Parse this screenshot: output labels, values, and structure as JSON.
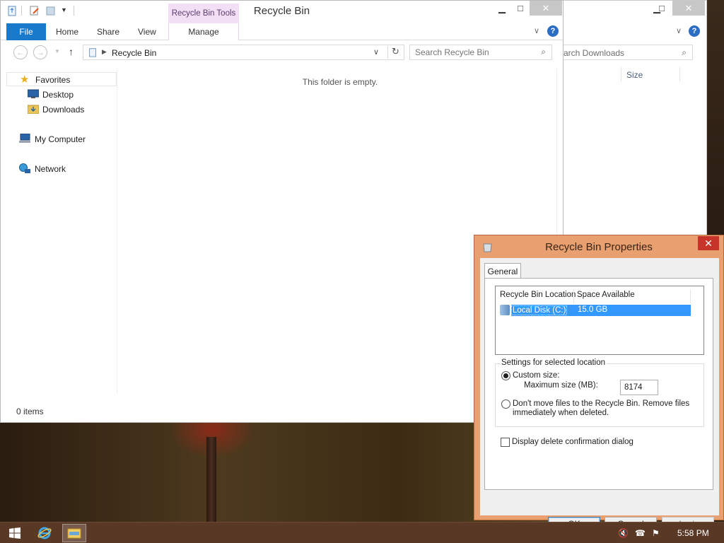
{
  "explorer": {
    "title": "Recycle Bin",
    "context_tab": "Recycle Bin Tools",
    "tabs": {
      "file": "File",
      "home": "Home",
      "share": "Share",
      "view": "View",
      "manage": "Manage"
    },
    "address": "Recycle Bin",
    "search_placeholder": "Search Recycle Bin",
    "nav": {
      "favorites": "Favorites",
      "desktop": "Desktop",
      "downloads": "Downloads",
      "my_computer": "My Computer",
      "network": "Network"
    },
    "empty_message": "This folder is empty.",
    "status": "0 items",
    "help": "?"
  },
  "downloads_window": {
    "search_placeholder": "arch Downloads",
    "column_size": "Size"
  },
  "dialog": {
    "title": "Recycle Bin Properties",
    "tab": "General",
    "columns": {
      "location": "Recycle Bin Location",
      "space": "Space Available"
    },
    "rows": [
      {
        "location": "Local Disk (C:)",
        "space": "15.0 GB"
      }
    ],
    "group_label": "Settings for selected location",
    "custom_size": "Custom size:",
    "max_size_label": "Maximum size (MB):",
    "max_size_value": "8174",
    "dont_move_line1": "Don't move files to the Recycle Bin. Remove files",
    "dont_move_line2": "immediately when deleted.",
    "confirm_label": "Display delete confirmation dialog",
    "buttons": {
      "ok": "OK",
      "cancel": "Cancel",
      "apply": "Apply"
    },
    "custom_size_selected": true,
    "confirm_checked": false
  },
  "taskbar": {
    "clock": "5:58 PM"
  },
  "colors": {
    "file_tab": "#1979ca",
    "context_tab": "#f3dff5",
    "dialog_frame": "#e8a070",
    "selection": "#3399ff",
    "close_button": "#c7352a",
    "taskbar": "#5a3826"
  }
}
